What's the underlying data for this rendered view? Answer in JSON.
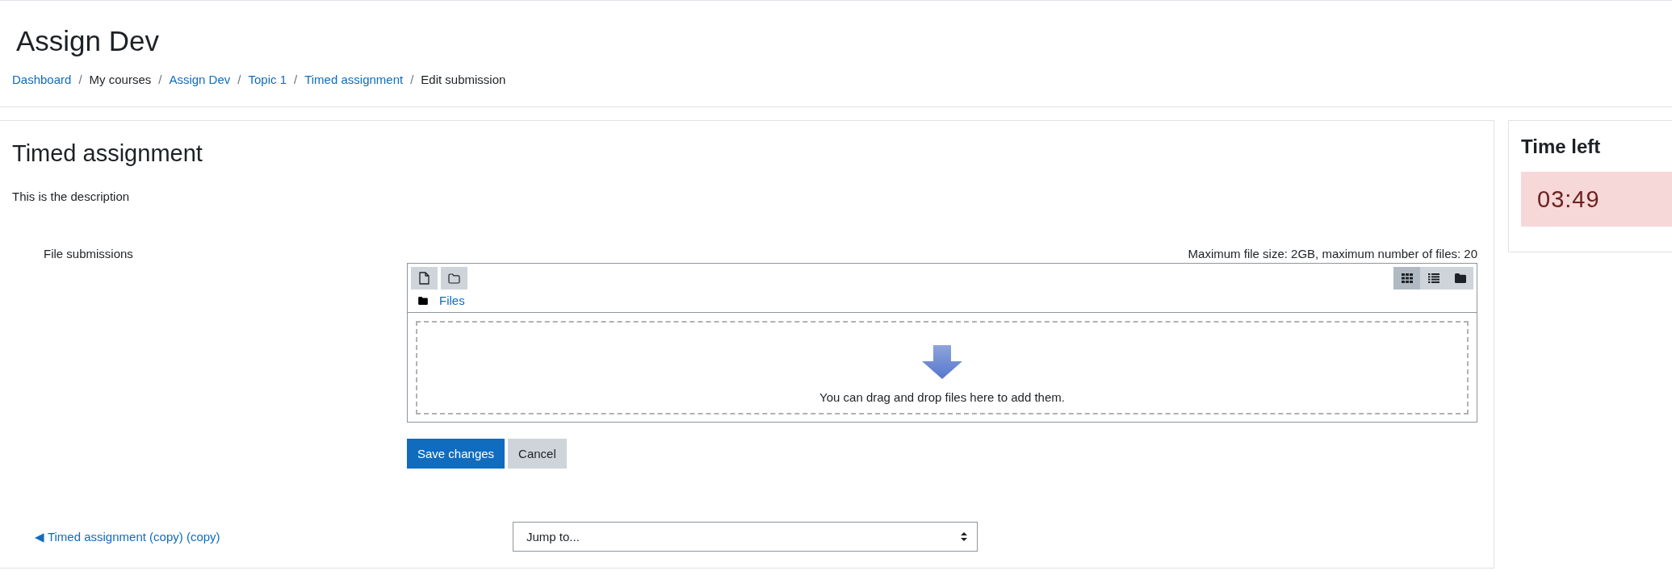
{
  "page_header": {
    "title": "Assign Dev",
    "breadcrumb": [
      {
        "label": "Dashboard",
        "link": true,
        "separator": "/"
      },
      {
        "label": "My courses",
        "link": false,
        "separator": "/"
      },
      {
        "label": "Assign Dev",
        "link": true,
        "separator": "/"
      },
      {
        "label": "Topic 1",
        "link": true,
        "separator": "/"
      },
      {
        "label": "Timed assignment",
        "link": true,
        "separator": "/"
      },
      {
        "label": "Edit submission",
        "link": false
      }
    ]
  },
  "assignment": {
    "title": "Timed assignment",
    "description": "This is the description",
    "file_submissions": {
      "label": "File submissions",
      "limits": "Maximum file size: 2GB, maximum number of files: 20",
      "view_modes": [
        {
          "kind": "icons",
          "selected": true
        },
        {
          "kind": "list",
          "selected": false
        },
        {
          "kind": "tree",
          "selected": false
        }
      ],
      "path": "Files",
      "dropzone_text": "You can drag and drop files here to add them."
    },
    "buttons": [
      {
        "label": "Save changes",
        "kind": "primary"
      },
      {
        "label": "Cancel",
        "kind": "secondary"
      }
    ],
    "navigation": {
      "previous": "◀ Timed assignment (copy) (copy)",
      "jump_to": "Jump to..."
    }
  },
  "timer": {
    "title": "Time left",
    "remaining": "03:49"
  }
}
